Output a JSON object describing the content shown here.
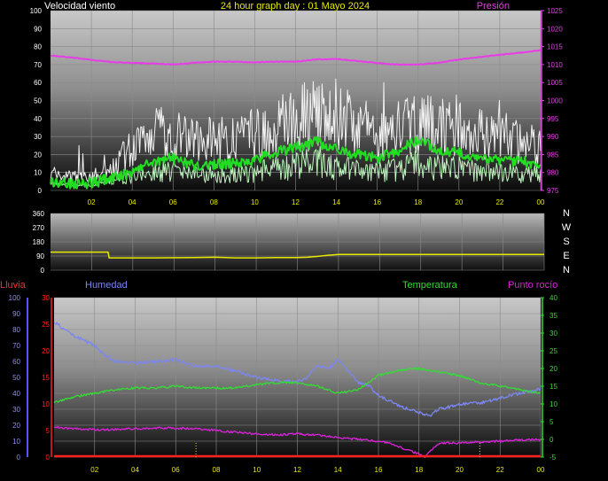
{
  "colors": {
    "wind_gust": "#f2f2f2",
    "wind_avg": "#22dd22",
    "wind_low": "#bdf3bd",
    "pressure": "#e83ce8",
    "direction": "#e8e800",
    "humidity": "#7c86f0",
    "temperature": "#33dd33",
    "dewpoint": "#dd22dd",
    "rain": "#ff2020",
    "rain_axis": "#5555ff",
    "title": "#e8e800",
    "xtick": "#e8e800",
    "grid": "#8a8a8a"
  },
  "chart_data": [
    {
      "type": "line",
      "title": "24 hour graph day : 01 Mayo 2024",
      "ylabel_left": "Velocidad viento",
      "ylabel_right": "Presión",
      "ylim_left": [
        0,
        100
      ],
      "ylim_right": [
        975,
        1025
      ],
      "yticks_left": [
        "0",
        "10",
        "20",
        "30",
        "40",
        "50",
        "60",
        "70",
        "80",
        "90",
        "100"
      ],
      "yticks_right": [
        "975",
        "980",
        "985",
        "990",
        "995",
        "1000",
        "1005",
        "1010",
        "1015",
        "1020",
        "1025"
      ],
      "xlim": [
        0,
        24
      ],
      "xticks": [
        "02",
        "04",
        "06",
        "08",
        "10",
        "12",
        "14",
        "16",
        "18",
        "20",
        "22",
        "00"
      ],
      "series": [
        {
          "name": "gust",
          "axis": "left",
          "x": [
            0,
            1,
            2,
            3,
            4,
            5,
            6,
            7,
            8,
            9,
            10,
            11,
            12,
            13,
            14,
            15,
            16,
            17,
            18,
            19,
            20,
            21,
            22,
            23,
            24
          ],
          "y": [
            10,
            8,
            7,
            12,
            25,
            32,
            35,
            28,
            30,
            29,
            33,
            36,
            42,
            44,
            40,
            35,
            33,
            36,
            40,
            36,
            35,
            32,
            30,
            28,
            26
          ]
        },
        {
          "name": "average",
          "axis": "left",
          "x": [
            0,
            1,
            2,
            3,
            4,
            5,
            6,
            7,
            8,
            9,
            10,
            11,
            12,
            13,
            14,
            15,
            16,
            17,
            18,
            19,
            20,
            21,
            22,
            23,
            24
          ],
          "y": [
            5,
            4,
            4,
            7,
            10,
            16,
            18,
            14,
            15,
            15,
            17,
            21,
            24,
            27,
            23,
            20,
            18,
            22,
            28,
            23,
            21,
            19,
            17,
            16,
            15
          ]
        },
        {
          "name": "low",
          "axis": "left",
          "x": [
            0,
            1,
            2,
            3,
            4,
            5,
            6,
            7,
            8,
            9,
            10,
            11,
            12,
            13,
            14,
            15,
            16,
            17,
            18,
            19,
            20,
            21,
            22,
            23,
            24
          ],
          "y": [
            2,
            1,
            1,
            3,
            5,
            8,
            9,
            7,
            7,
            7,
            8,
            10,
            12,
            14,
            11,
            9,
            8,
            10,
            13,
            11,
            10,
            9,
            8,
            7,
            7
          ]
        },
        {
          "name": "pressure",
          "axis": "right",
          "x": [
            0,
            1,
            2,
            3,
            4,
            5,
            6,
            7,
            8,
            9,
            10,
            11,
            12,
            13,
            14,
            15,
            16,
            17,
            18,
            19,
            20,
            21,
            22,
            23,
            24
          ],
          "y": [
            1012.5,
            1012,
            1011.3,
            1010.7,
            1010.5,
            1010.3,
            1010,
            1010.5,
            1010.8,
            1010.8,
            1010.6,
            1010.8,
            1010.8,
            1011.4,
            1011.6,
            1011,
            1010.4,
            1010,
            1010,
            1010.5,
            1011.4,
            1012.1,
            1012.7,
            1013.3,
            1014
          ]
        }
      ]
    },
    {
      "type": "line",
      "ylim": [
        0,
        360
      ],
      "yticks": [
        "0",
        "90",
        "180",
        "270",
        "360"
      ],
      "compass_labels": [
        "N",
        "W",
        "S",
        "E",
        "N"
      ],
      "xlim": [
        0,
        24
      ],
      "series": [
        {
          "name": "direction",
          "x": [
            0,
            2.8,
            2.85,
            3,
            5,
            7,
            8,
            9,
            10,
            11,
            12,
            12.5,
            13,
            13.5,
            14,
            15,
            16,
            18,
            20,
            22,
            24
          ],
          "y": [
            115,
            115,
            78,
            78,
            78,
            80,
            82,
            78,
            78,
            80,
            80,
            82,
            88,
            95,
            100,
            100,
            100,
            100,
            100,
            100,
            100
          ]
        }
      ]
    },
    {
      "type": "line",
      "ylabel_rain": "Lluvia",
      "ylabel_humidity": "Humedad",
      "ylabel_temperature": "Temperatura",
      "ylabel_dewpoint": "Punto rocío",
      "ylim_humidity": [
        0,
        100
      ],
      "ylim_rain": [
        0,
        30
      ],
      "ylim_temperature": [
        -5,
        40
      ],
      "yticks_humidity": [
        "0",
        "10",
        "20",
        "30",
        "40",
        "50",
        "60",
        "70",
        "80",
        "90",
        "100"
      ],
      "yticks_rain": [
        "0",
        "5",
        "10",
        "15",
        "20",
        "25",
        "30"
      ],
      "yticks_temperature": [
        "-5",
        "0",
        "5",
        "10",
        "15",
        "20",
        "25",
        "30",
        "35",
        "40"
      ],
      "xlim": [
        0,
        24
      ],
      "xticks": [
        "02",
        "04",
        "06",
        "08",
        "10",
        "12",
        "14",
        "16",
        "18",
        "20",
        "22",
        "00"
      ],
      "series": [
        {
          "name": "humidity",
          "axis": "humidity",
          "x": [
            0,
            0.5,
            1,
            1.5,
            2,
            2.5,
            3,
            4,
            5,
            6,
            7,
            8,
            9,
            9.5,
            10,
            11,
            12,
            12.5,
            13,
            13.5,
            14,
            14.5,
            15,
            15.5,
            16,
            17,
            18,
            18.5,
            19,
            20,
            21,
            22,
            23,
            24
          ],
          "y": [
            85,
            80,
            76,
            73,
            70,
            64,
            60,
            59,
            60,
            61,
            57,
            57,
            54,
            52,
            50,
            48,
            47,
            50,
            58,
            55,
            61,
            54,
            47,
            45,
            39,
            32,
            28,
            26,
            30,
            33,
            34,
            37,
            40,
            43
          ]
        },
        {
          "name": "temperature",
          "axis": "temperature",
          "x": [
            0,
            1,
            2,
            3,
            4,
            5,
            6,
            7,
            8,
            9,
            10,
            11,
            12,
            13,
            14,
            15,
            16,
            17,
            18,
            19,
            20,
            21,
            22,
            23,
            24
          ],
          "y": [
            10.5,
            12,
            13,
            14,
            14.5,
            14.5,
            15,
            14.5,
            14.5,
            14.5,
            15.5,
            16,
            16,
            15,
            13,
            14,
            18,
            19.5,
            20,
            19,
            18,
            16,
            15,
            14,
            13
          ]
        },
        {
          "name": "dewpoint",
          "axis": "temperature",
          "x": [
            0,
            1,
            2,
            3,
            4,
            5,
            6,
            7,
            8,
            9,
            10,
            11,
            12,
            13,
            14,
            15,
            16,
            16.5,
            17,
            17.5,
            18,
            18.3,
            18.6,
            19,
            20,
            21,
            22,
            23,
            24
          ],
          "y": [
            3.5,
            3,
            2.7,
            2.8,
            3,
            3.2,
            3.2,
            3,
            2.5,
            2,
            1.5,
            1.3,
            1.5,
            1.2,
            0.5,
            0,
            -0.5,
            -1,
            -2,
            -3.2,
            -4,
            -5,
            -3,
            -1,
            -1,
            -0.7,
            -0.5,
            -0.2,
            0
          ]
        },
        {
          "name": "rain",
          "axis": "rain",
          "x": [
            0,
            24
          ],
          "y": [
            0,
            0
          ]
        }
      ]
    }
  ]
}
